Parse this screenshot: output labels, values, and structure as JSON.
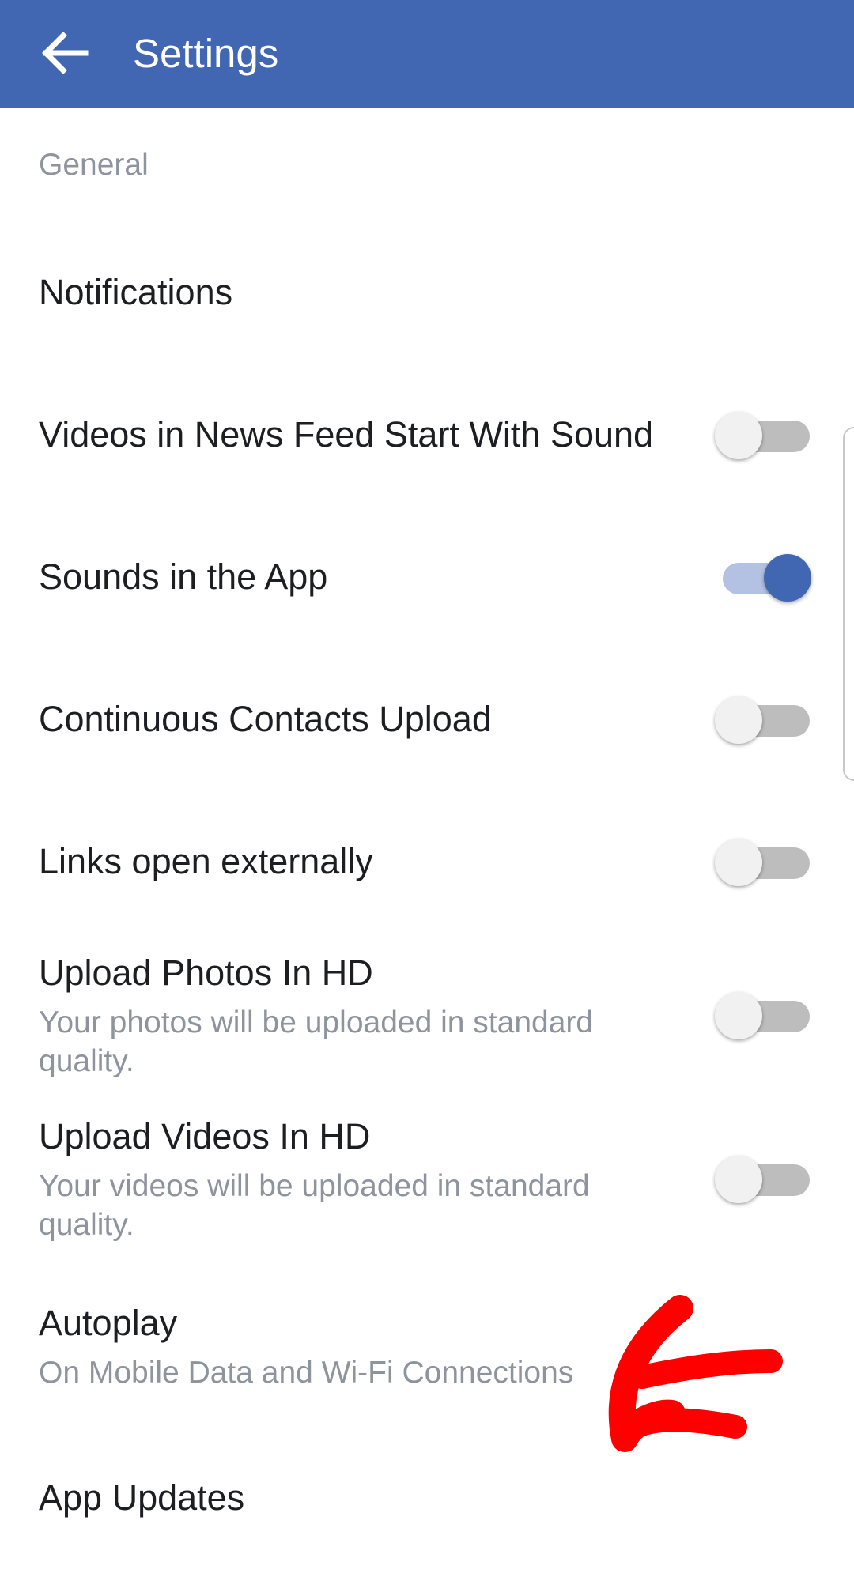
{
  "app_bar": {
    "title": "Settings",
    "back_icon": "arrow-left-icon",
    "background_color": "#4267b2"
  },
  "section": {
    "header": "General"
  },
  "settings": {
    "notifications": {
      "title": "Notifications"
    },
    "videos_sound": {
      "title": "Videos in News Feed Start With Sound",
      "enabled": false
    },
    "sounds_app": {
      "title": "Sounds in the App",
      "enabled": true
    },
    "contacts_upload": {
      "title": "Continuous Contacts Upload",
      "enabled": false
    },
    "links_external": {
      "title": "Links open externally",
      "enabled": false
    },
    "photos_hd": {
      "title": "Upload Photos In HD",
      "subtitle": "Your photos will be uploaded in standard quality.",
      "enabled": false
    },
    "videos_hd": {
      "title": "Upload Videos In HD",
      "subtitle": "Your videos will be uploaded in standard quality.",
      "enabled": false
    },
    "autoplay": {
      "title": "Autoplay",
      "subtitle": "On Mobile Data and Wi-Fi Connections"
    },
    "app_updates": {
      "title": "App Updates"
    }
  },
  "colors": {
    "accent": "#4267b2",
    "toggle_on_track": "#b3c1e3",
    "toggle_off_track": "#bdbdbd",
    "annotation": "#ff0000"
  }
}
